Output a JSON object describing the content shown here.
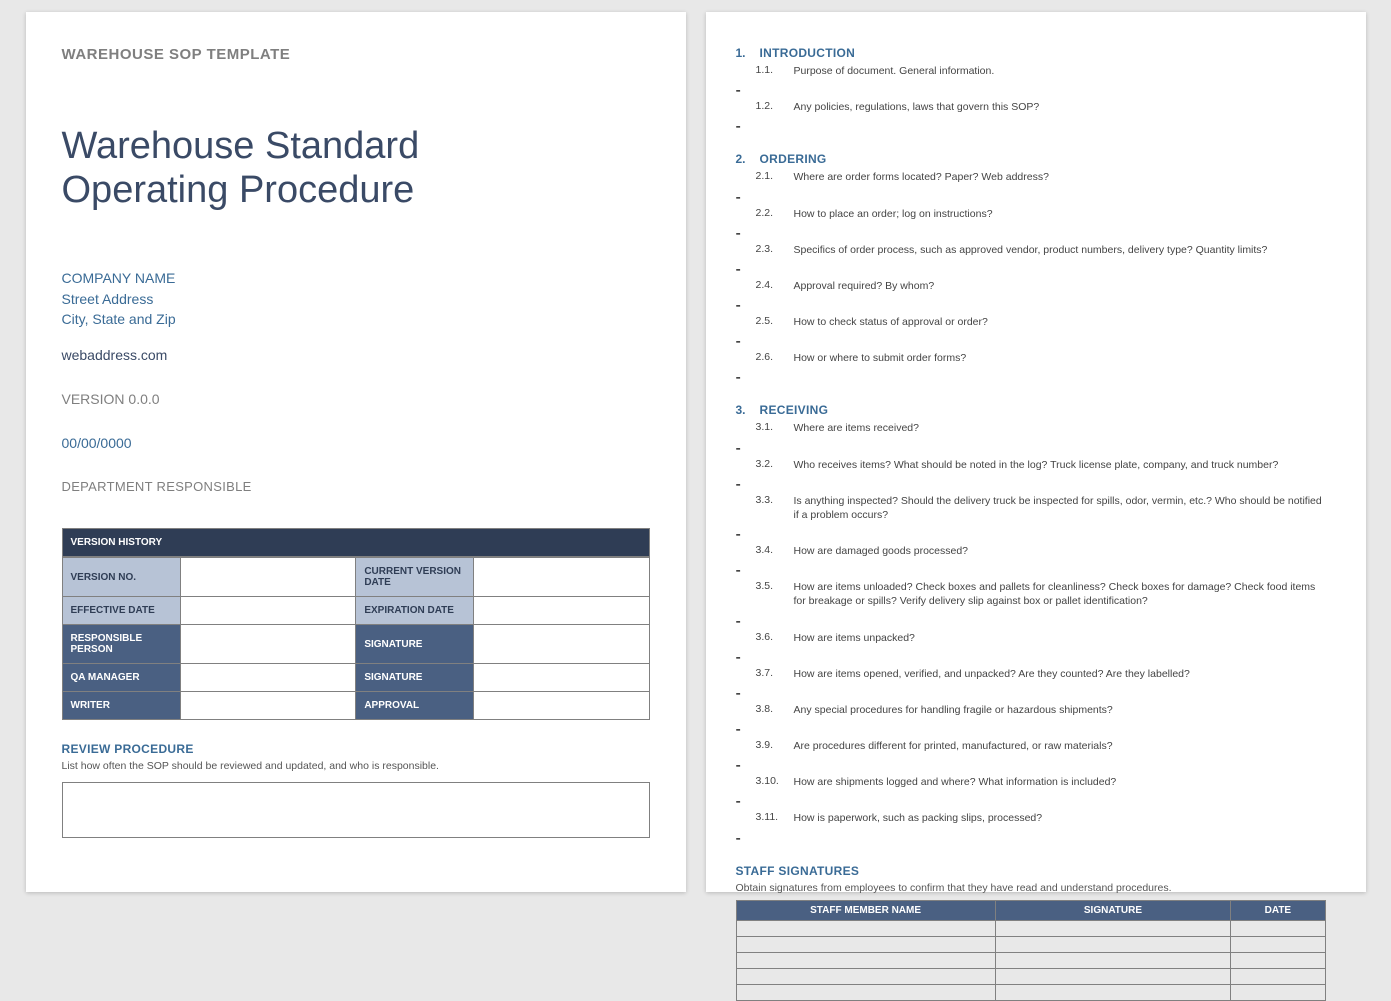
{
  "template_heading": "WAREHOUSE SOP TEMPLATE",
  "title_line1": "Warehouse Standard",
  "title_line2": "Operating Procedure",
  "company": {
    "name": "COMPANY NAME",
    "street": "Street Address",
    "city": "City, State and Zip",
    "web": "webaddress.com"
  },
  "version_label": "VERSION 0.0.0",
  "date_label": "00/00/0000",
  "department_label": "DEPARTMENT RESPONSIBLE",
  "version_history": {
    "header": "VERSION HISTORY",
    "rows": [
      {
        "l1": "VERSION NO.",
        "l2": "CURRENT VERSION DATE",
        "style": "light"
      },
      {
        "l1": "EFFECTIVE DATE",
        "l2": "EXPIRATION DATE",
        "style": "light"
      },
      {
        "l1": "RESPONSIBLE PERSON",
        "l2": "SIGNATURE",
        "style": "dark"
      },
      {
        "l1": "QA MANAGER",
        "l2": "SIGNATURE",
        "style": "dark"
      },
      {
        "l1": "WRITER",
        "l2": "APPROVAL",
        "style": "dark"
      }
    ]
  },
  "review": {
    "heading": "REVIEW PROCEDURE",
    "sub": "List how often the SOP should be reviewed and updated, and who is responsible."
  },
  "toc": [
    {
      "num": "1.",
      "title": "INTRODUCTION",
      "items": [
        {
          "n": "1.1.",
          "t": "Purpose of document. General information."
        },
        {
          "n": "1.2.",
          "t": "Any policies, regulations, laws that govern this SOP?"
        }
      ]
    },
    {
      "num": "2.",
      "title": "ORDERING",
      "items": [
        {
          "n": "2.1.",
          "t": "Where are order forms located? Paper? Web address?"
        },
        {
          "n": "2.2.",
          "t": "How to place an order; log on instructions?"
        },
        {
          "n": "2.3.",
          "t": "Specifics of order process, such as approved vendor, product numbers, delivery type? Quantity limits?"
        },
        {
          "n": "2.4.",
          "t": "Approval required? By whom?"
        },
        {
          "n": "2.5.",
          "t": "How to check status of approval or order?"
        },
        {
          "n": "2.6.",
          "t": "How or where to submit order forms?"
        }
      ]
    },
    {
      "num": "3.",
      "title": "RECEIVING",
      "items": [
        {
          "n": "3.1.",
          "t": "Where are items received?"
        },
        {
          "n": "3.2.",
          "t": "Who receives items? What should be noted in the log? Truck license plate, company, and truck number?"
        },
        {
          "n": "3.3.",
          "t": "Is anything inspected? Should the delivery truck be inspected for spills, odor, vermin, etc.? Who should be notified if a problem occurs?"
        },
        {
          "n": "3.4.",
          "t": "How are damaged goods processed?"
        },
        {
          "n": "3.5.",
          "t": "How are items unloaded? Check boxes and pallets for cleanliness? Check boxes for damage? Check food items for breakage or spills? Verify delivery slip against box or pallet identification?"
        },
        {
          "n": "3.6.",
          "t": "How are items unpacked?"
        },
        {
          "n": "3.7.",
          "t": "How are items opened, verified, and unpacked? Are they counted? Are they labelled?"
        },
        {
          "n": "3.8.",
          "t": "Any special procedures for handling fragile or hazardous shipments?"
        },
        {
          "n": "3.9.",
          "t": "Are procedures different for printed, manufactured, or raw materials?"
        },
        {
          "n": "3.10.",
          "t": "How are shipments logged and where? What information is included?"
        },
        {
          "n": "3.11.",
          "t": "How is paperwork, such as packing slips, processed?"
        }
      ]
    }
  ],
  "staff": {
    "heading": "STAFF SIGNATURES",
    "sub": "Obtain signatures from employees to confirm that they have read and understand procedures.",
    "cols": [
      "STAFF MEMBER NAME",
      "SIGNATURE",
      "DATE"
    ],
    "row_count": 5
  }
}
